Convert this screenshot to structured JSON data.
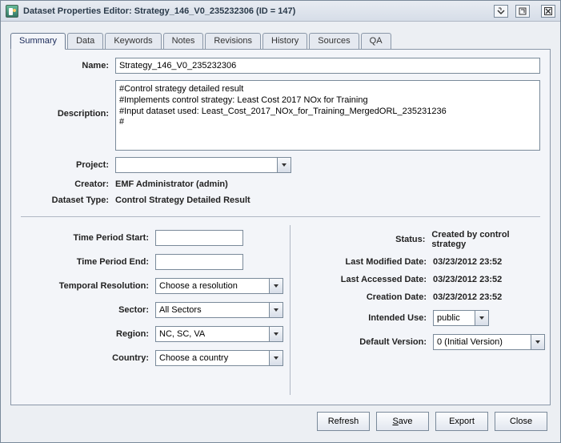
{
  "titlebar": {
    "title": "Dataset Properties Editor: Strategy_146_V0_235232306 (ID = 147)"
  },
  "tabs": [
    "Summary",
    "Data",
    "Keywords",
    "Notes",
    "Revisions",
    "History",
    "Sources",
    "QA"
  ],
  "labels": {
    "name": "Name:",
    "description": "Description:",
    "project": "Project:",
    "creator": "Creator:",
    "dataset_type": "Dataset Type:",
    "time_start": "Time Period Start:",
    "time_end": "Time Period End:",
    "temporal_res": "Temporal Resolution:",
    "sector": "Sector:",
    "region": "Region:",
    "country": "Country:",
    "status": "Status:",
    "last_modified": "Last Modified Date:",
    "last_accessed": "Last Accessed Date:",
    "creation_date": "Creation Date:",
    "intended_use": "Intended Use:",
    "default_version": "Default Version:"
  },
  "values": {
    "name": "Strategy_146_V0_235232306",
    "description": "#Control strategy detailed result\n#Implements control strategy: Least Cost 2017 NOx for Training\n#Input dataset used: Least_Cost_2017_NOx_for_Training_MergedORL_235231236\n#",
    "project": "",
    "creator": "EMF Administrator (admin)",
    "dataset_type": "Control Strategy Detailed Result",
    "time_start": "",
    "time_end": "",
    "temporal_res": "Choose a resolution",
    "sector": "All Sectors",
    "region": "NC, SC, VA",
    "country": "Choose a country",
    "status": "Created by control strategy",
    "last_modified": "03/23/2012 23:52",
    "last_accessed": "03/23/2012 23:52",
    "creation_date": "03/23/2012 23:52",
    "intended_use": "public",
    "default_version": "0 (Initial Version)"
  },
  "buttons": {
    "refresh": "Refresh",
    "save": "ave",
    "save_mn": "S",
    "export": "Export",
    "close": "Close"
  }
}
